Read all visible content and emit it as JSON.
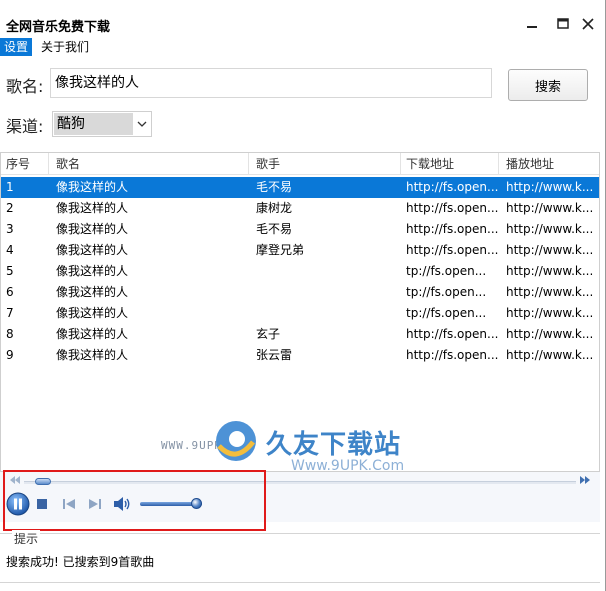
{
  "window": {
    "title": "全网音乐免费下载"
  },
  "menu": {
    "settings": "设置",
    "about": "关于我们"
  },
  "search": {
    "song_label": "歌名:",
    "song_value": "像我这样的人",
    "button": "搜索",
    "channel_label": "渠道:",
    "channel_value": "酷狗"
  },
  "table": {
    "headers": [
      "序号",
      "歌名",
      "歌手",
      "下载地址",
      "播放地址"
    ],
    "rows": [
      [
        "1",
        "像我这样的人",
        "毛不易",
        "http://fs.open...",
        "http://www.k..."
      ],
      [
        "2",
        "像我这样的人",
        "康树龙",
        "http://fs.open...",
        "http://www.k..."
      ],
      [
        "3",
        "像我这样的人",
        "毛不易",
        "http://fs.open...",
        "http://www.k..."
      ],
      [
        "4",
        "像我这样的人",
        "摩登兄弟",
        "http://fs.open...",
        "http://www.k..."
      ],
      [
        "5",
        "像我这样的人",
        "",
        "tp://fs.open...",
        "http://www.k..."
      ],
      [
        "6",
        "像我这样的人",
        "",
        "tp://fs.open...",
        "http://www.k..."
      ],
      [
        "7",
        "像我这样的人",
        "",
        "tp://fs.open...",
        "http://www.k..."
      ],
      [
        "8",
        "像我这样的人",
        "玄子",
        "http://fs.open...",
        "http://www.k..."
      ],
      [
        "9",
        "像我这样的人",
        "张云雷",
        "http://fs.open...",
        "http://www.k..."
      ]
    ],
    "selected_row": 0
  },
  "watermark": {
    "url": "WWW.9UPK.COM",
    "brand": "久友下载站",
    "sub": "Www.9UPK.Com"
  },
  "player": {
    "progress": 0.02,
    "volume": 0.9
  },
  "hint": {
    "title": "提示",
    "message": "搜索成功! 已搜索到9首歌曲"
  },
  "colors": {
    "accent": "#0a78d7",
    "highlight": "#e01a1a"
  }
}
